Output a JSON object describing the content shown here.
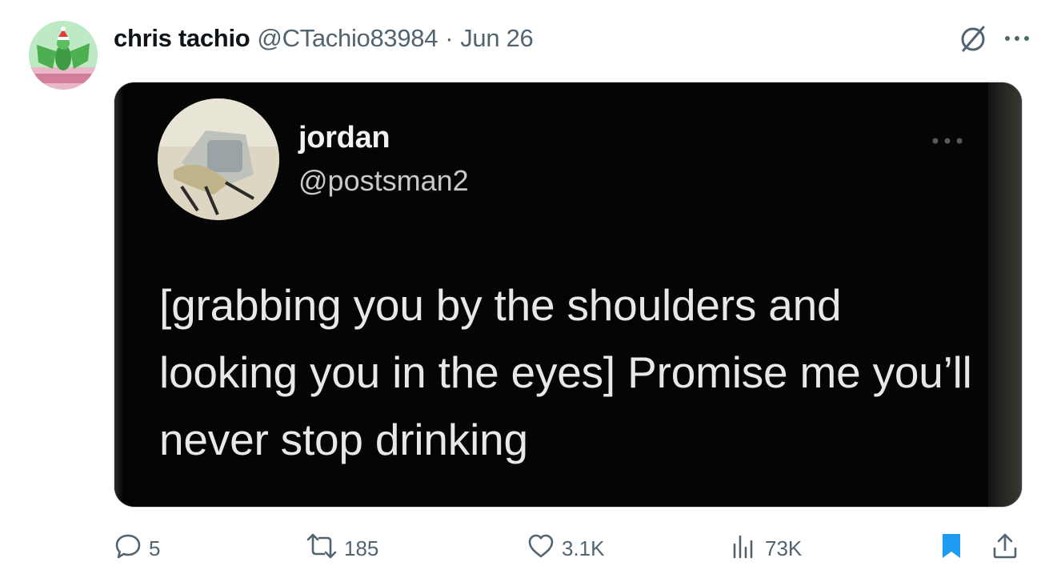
{
  "author": {
    "display_name": "chris tachio",
    "handle": "@CTachio83984",
    "separator": "·",
    "date": "Jun 26"
  },
  "header_icons": {
    "grok": "grok-slash-circle-icon",
    "more": "more-horizontal-icon"
  },
  "media": {
    "quoted_name": "jordan",
    "quoted_handle": "@postsman2",
    "quoted_text": "[grabbing you by the shoulders and looking you in the eyes] Promise me you’ll never stop drinking"
  },
  "actions": {
    "replies": "5",
    "reposts": "185",
    "likes": "3.1K",
    "views": "73K"
  },
  "colors": {
    "text_primary": "#0f1419",
    "text_secondary": "#536471",
    "bookmark_active": "#1d9bf0"
  }
}
